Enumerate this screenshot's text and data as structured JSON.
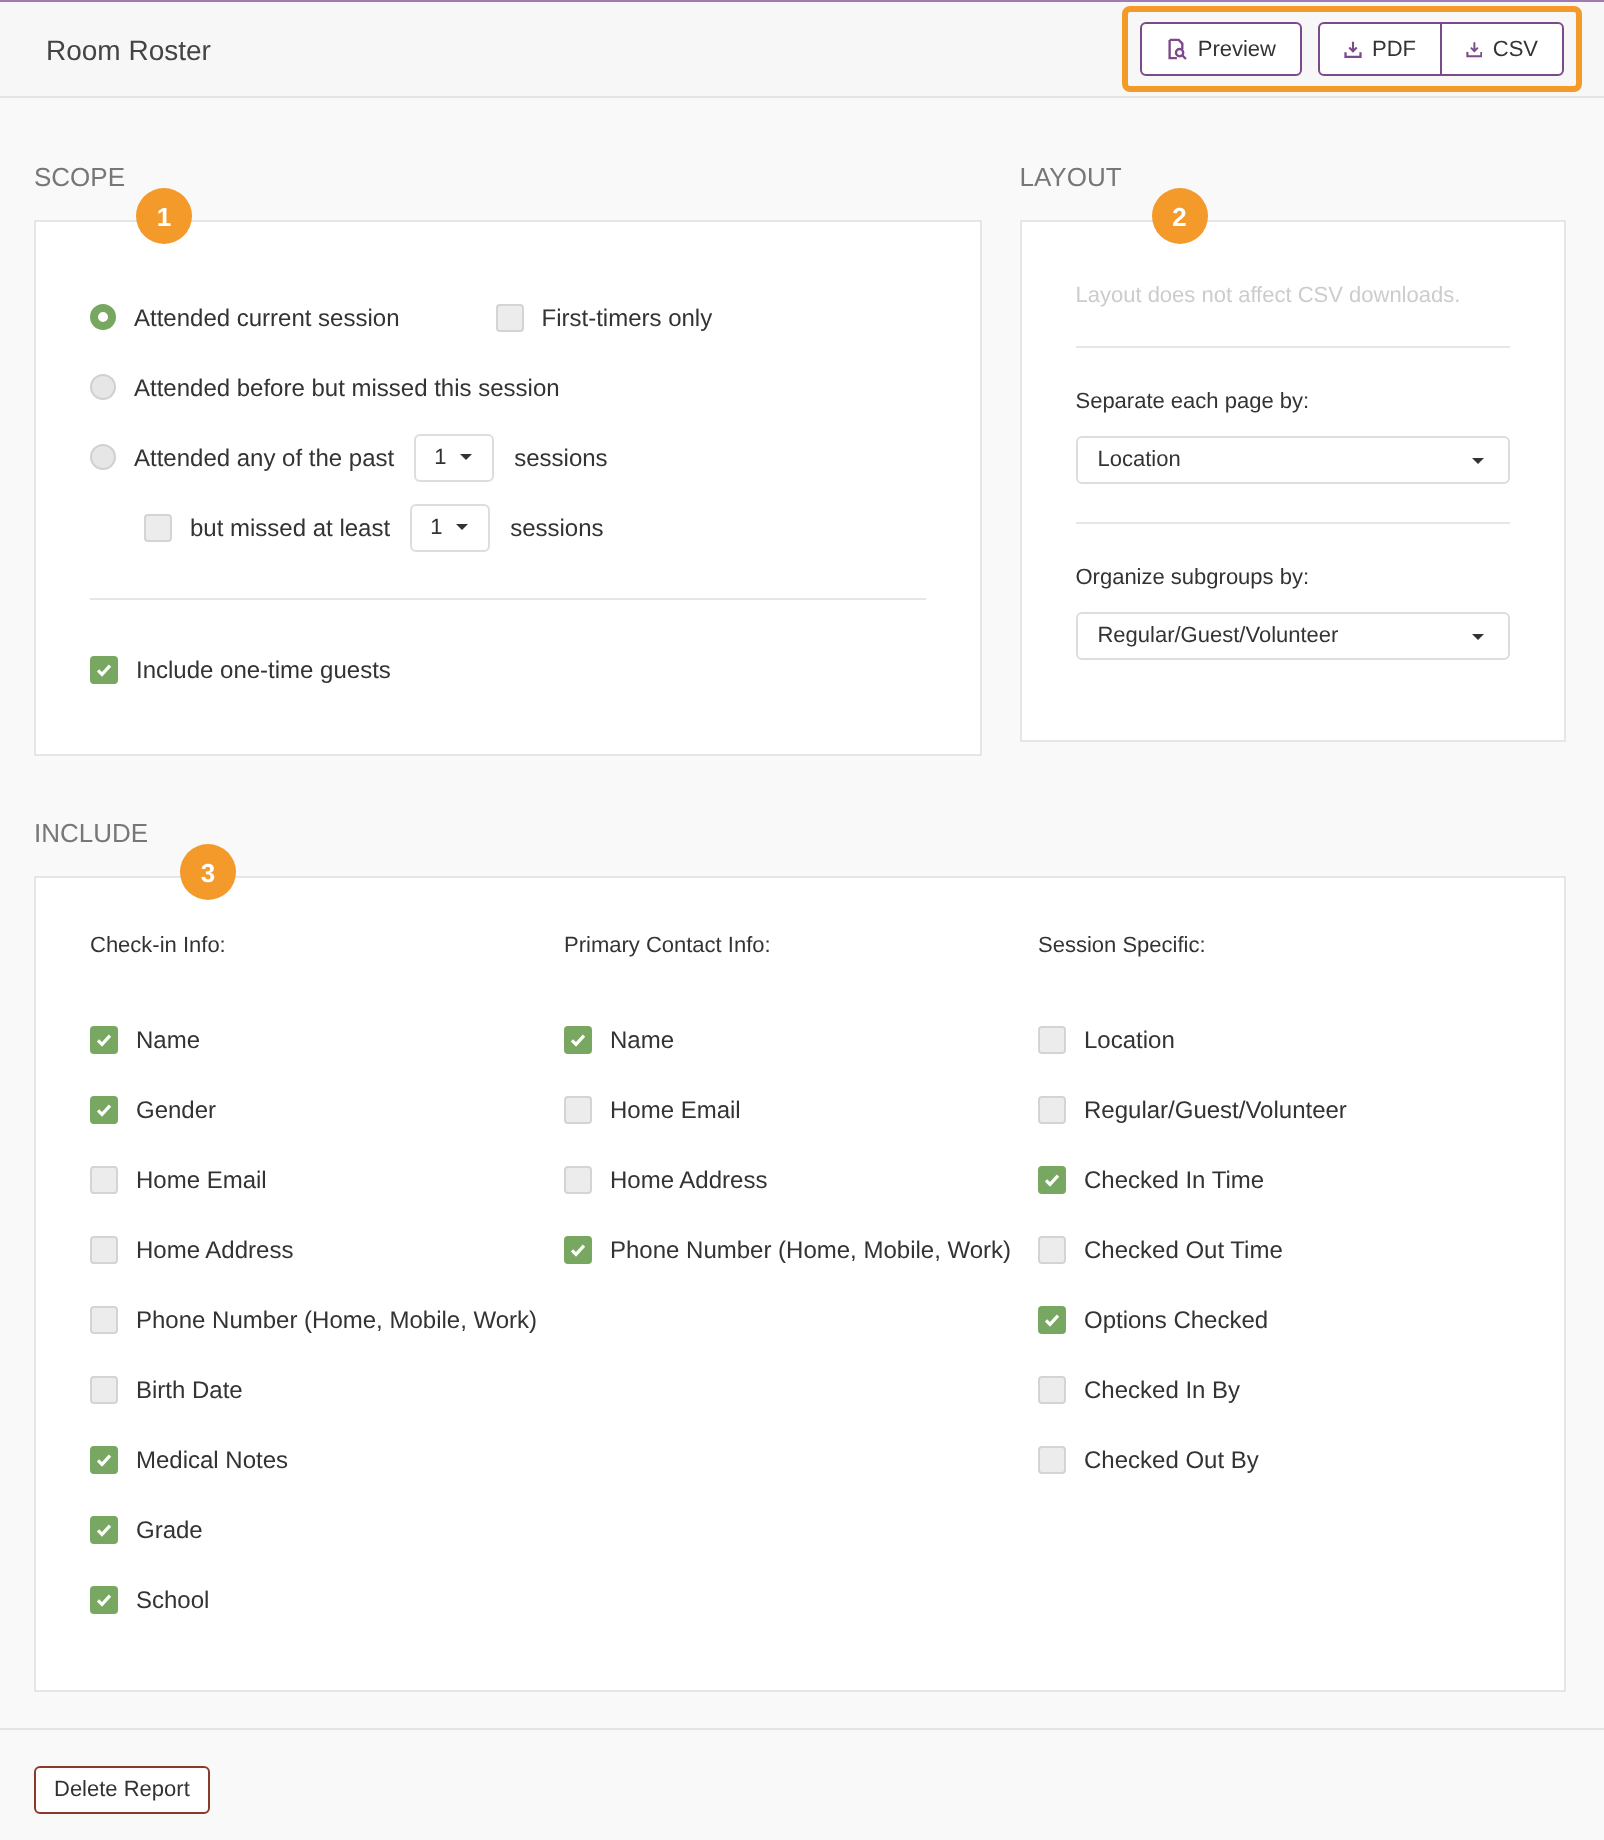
{
  "header": {
    "title": "Room Roster",
    "buttons": [
      {
        "kind": "preview",
        "label": "Preview"
      },
      {
        "kind": "download",
        "label": "PDF"
      },
      {
        "kind": "download",
        "label": "CSV"
      }
    ]
  },
  "scope": {
    "title": "SCOPE",
    "badge": "1",
    "rows": [
      {
        "indented": false,
        "items": [
          {
            "kind": "radio",
            "label": "Attended current session",
            "selected": true
          },
          {
            "kind": "checkbox",
            "label": "First-timers only",
            "checked": false
          }
        ]
      },
      {
        "indented": false,
        "items": [
          {
            "kind": "radio",
            "label": "Attended before but missed this session",
            "selected": false
          }
        ]
      },
      {
        "indented": false,
        "items": [
          {
            "kind": "radio",
            "label": "Attended any of the past",
            "selected": false
          },
          {
            "kind": "select",
            "value": "1"
          },
          {
            "kind": "text",
            "text": "sessions"
          }
        ]
      },
      {
        "indented": true,
        "items": [
          {
            "kind": "checkbox",
            "label": "but missed at least",
            "checked": false
          },
          {
            "kind": "select",
            "value": "1"
          },
          {
            "kind": "text",
            "text": "sessions"
          }
        ]
      }
    ],
    "guests": {
      "label": "Include one-time guests",
      "checked": true
    }
  },
  "layout": {
    "title": "LAYOUT",
    "badge": "2",
    "note": "Layout does not affect CSV downloads.",
    "fields": [
      {
        "label": "Separate each page by:",
        "value": "Location"
      },
      {
        "label": "Organize subgroups by:",
        "value": "Regular/Guest/Volunteer"
      }
    ]
  },
  "include": {
    "title": "INCLUDE",
    "badge": "3",
    "columns": [
      {
        "heading": "Check-in Info:",
        "items": [
          {
            "label": "Name",
            "checked": true
          },
          {
            "label": "Gender",
            "checked": true
          },
          {
            "label": "Home Email",
            "checked": false
          },
          {
            "label": "Home Address",
            "checked": false
          },
          {
            "label": "Phone Number (Home, Mobile, Work)",
            "checked": false
          },
          {
            "label": "Birth Date",
            "checked": false
          },
          {
            "label": "Medical Notes",
            "checked": true
          },
          {
            "label": "Grade",
            "checked": true
          },
          {
            "label": "School",
            "checked": true
          }
        ]
      },
      {
        "heading": "Primary Contact Info:",
        "items": [
          {
            "label": "Name",
            "checked": true
          },
          {
            "label": "Home Email",
            "checked": false
          },
          {
            "label": "Home Address",
            "checked": false
          },
          {
            "label": "Phone Number (Home, Mobile, Work)",
            "checked": true
          }
        ]
      },
      {
        "heading": "Session Specific:",
        "items": [
          {
            "label": "Location",
            "checked": false
          },
          {
            "label": "Regular/Guest/Volunteer",
            "checked": false
          },
          {
            "label": "Checked In Time",
            "checked": true
          },
          {
            "label": "Checked Out Time",
            "checked": false
          },
          {
            "label": "Options Checked",
            "checked": true
          },
          {
            "label": "Checked In By",
            "checked": false
          },
          {
            "label": "Checked Out By",
            "checked": false
          }
        ]
      }
    ]
  },
  "footer": {
    "delete_label": "Delete Report"
  }
}
